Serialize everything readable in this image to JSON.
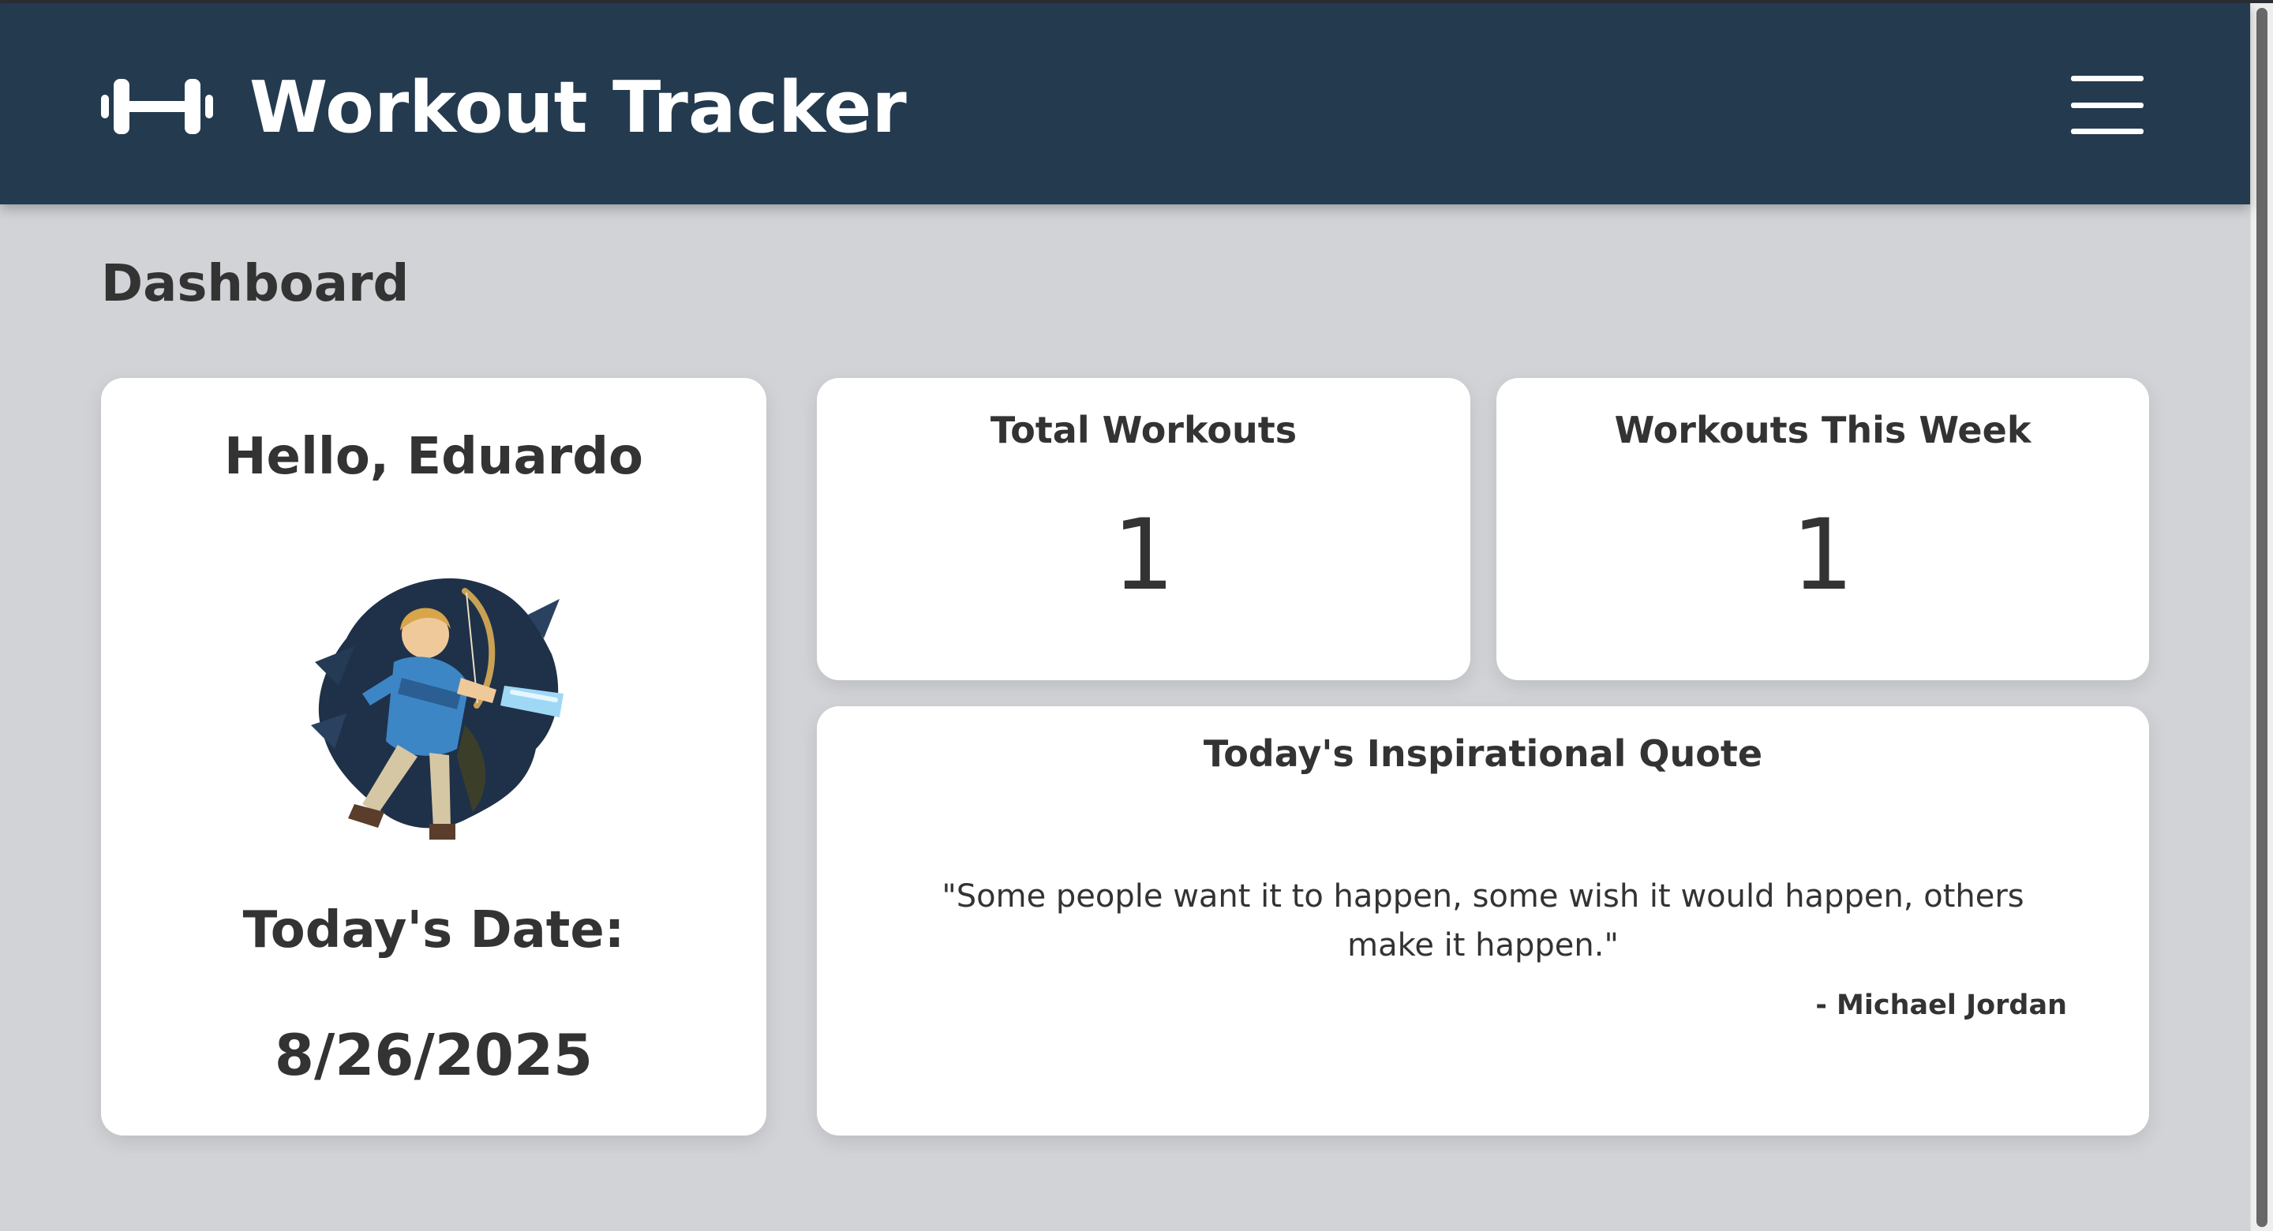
{
  "navbar": {
    "brand_icon": "dumbbell-icon",
    "title": "Workout Tracker",
    "menu_icon": "hamburger-menu-icon"
  },
  "page": {
    "title": "Dashboard"
  },
  "profile": {
    "greeting": "Hello, Eduardo",
    "avatar_alt": "Avatar",
    "date_label": "Today's Date:",
    "date_value": "8/26/2025"
  },
  "stats": {
    "total_workouts": {
      "label": "Total Workouts",
      "value": "1"
    },
    "workouts_this_week": {
      "label": "Workouts This Week",
      "value": "1"
    }
  },
  "quote": {
    "title": "Today's Inspirational Quote",
    "text": "\"Some people want it to happen, some wish it would happen, others make it happen.\"",
    "author": "- Michael Jordan"
  },
  "colors": {
    "navbar_bg": "#243a4f",
    "page_bg": "#d1d3d7",
    "card_bg": "#ffffff",
    "text": "#333333"
  }
}
